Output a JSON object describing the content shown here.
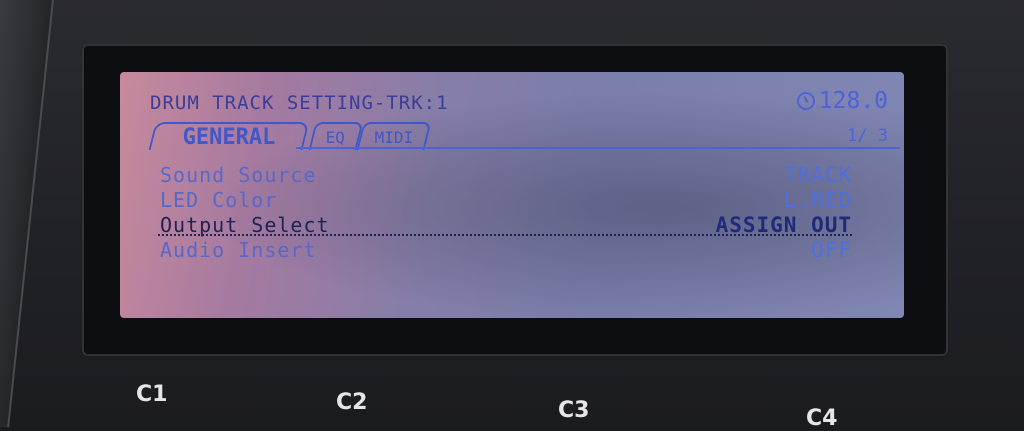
{
  "header": {
    "title": "DRUM TRACK SETTING-TRK:1",
    "tempo": "128.0",
    "tempo_icon": "metronome-icon"
  },
  "tabs": [
    {
      "label": "GENERAL",
      "active": true
    },
    {
      "label": "EQ",
      "active": false
    },
    {
      "label": "MIDI",
      "active": false
    }
  ],
  "page": "1/ 3",
  "params": [
    {
      "label": "Sound Source",
      "value": "TRACK",
      "selected": false
    },
    {
      "label": "LED Color",
      "value": "L.RED",
      "selected": false
    },
    {
      "label": "Output Select",
      "value": "ASSIGN OUT",
      "selected": true
    },
    {
      "label": "Audio Insert",
      "value": "OFF",
      "selected": false
    }
  ],
  "knobs": [
    "C1",
    "C2",
    "C3",
    "C4"
  ],
  "colors": {
    "lcd_text": "#3c3fa0",
    "lcd_accent": "#4c63d8",
    "selected_text": "#1f2255"
  }
}
